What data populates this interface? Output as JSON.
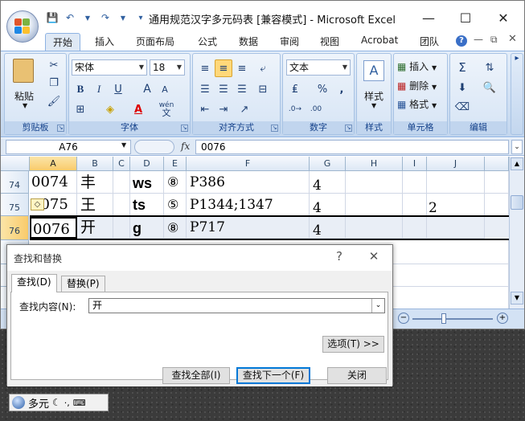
{
  "window": {
    "title": "通用规范汉字多元码表  [兼容模式]  -  Microsoft Excel",
    "controls": {
      "minimize": "—",
      "maximize": "☐",
      "close": "✕"
    }
  },
  "ribbon": {
    "tabs": [
      "开始",
      "插入",
      "页面布局",
      "公式",
      "数据",
      "审阅",
      "视图",
      "Acrobat",
      "团队"
    ],
    "groups": {
      "clipboard": {
        "label": "剪贴板",
        "paste": "粘贴"
      },
      "font": {
        "label": "字体",
        "font_name": "宋体",
        "font_size": "18",
        "bold": "B",
        "italic": "I",
        "underline": "U",
        "grow": "A",
        "shrink": "A",
        "font_color": "A",
        "wen": "wén",
        "wen_char": "文"
      },
      "alignment": {
        "label": "对齐方式"
      },
      "number": {
        "label": "数字",
        "format": "文本",
        "percent": "%",
        "comma": ","
      },
      "styles": {
        "label": "样式"
      },
      "cells": {
        "label": "单元格",
        "insert": "插入",
        "delete": "删除",
        "format": "格式"
      },
      "editing": {
        "label": "编辑",
        "sum": "Σ"
      }
    },
    "help": "?"
  },
  "formula_bar": {
    "name_box": "A76",
    "fx": "fx",
    "value": "0076"
  },
  "grid": {
    "columns": [
      "A",
      "B",
      "C",
      "D",
      "E",
      "F",
      "G",
      "H",
      "I",
      "J"
    ],
    "selected_column": "A",
    "rows": [
      {
        "num": "74",
        "A": "0074",
        "B": "丰",
        "C": "",
        "D": "ws",
        "E": "⑧",
        "F": "P386",
        "G": "4",
        "H": "",
        "I": "",
        "J": ""
      },
      {
        "num": "75",
        "A": "0075",
        "B": "王",
        "C": "",
        "D": "ts",
        "E": "⑤",
        "F": "P1344;1347",
        "G": "4",
        "H": "",
        "I": "",
        "J": "2"
      },
      {
        "num": "76",
        "A": "0076",
        "B": "开",
        "C": "",
        "D": "g",
        "E": "⑧",
        "F": "P717",
        "G": "4",
        "H": "",
        "I": "",
        "J": ""
      }
    ]
  },
  "find_dialog": {
    "title": "查找和替换",
    "help": "?",
    "close": "✕",
    "tabs": [
      "查找(D)",
      "替换(P)"
    ],
    "find_label": "查找内容(N):",
    "find_value": "开",
    "options_button": "选项(T) >>",
    "find_all_button": "查找全部(I)",
    "find_next_button": "查找下一个(F)",
    "close_button": "关闭"
  },
  "ime": {
    "mode": "多元",
    "punct": "·,"
  }
}
